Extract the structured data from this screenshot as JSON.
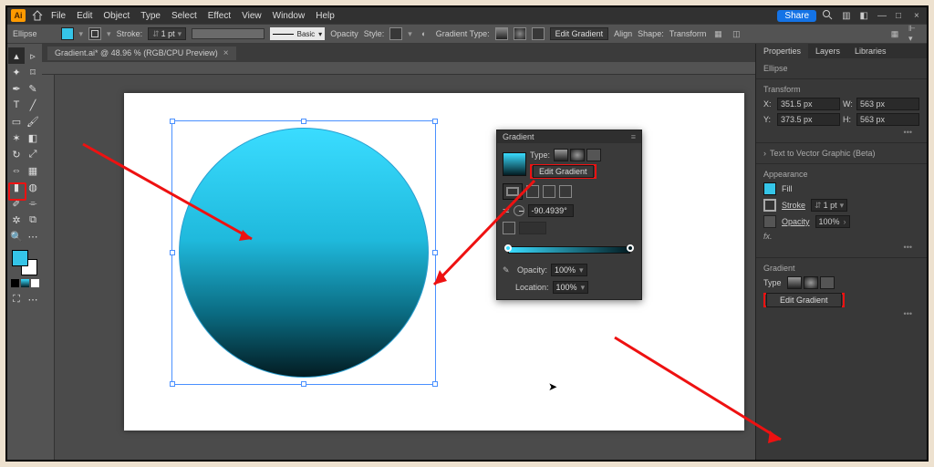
{
  "app": {
    "name": "Ai"
  },
  "menu": {
    "items": [
      "File",
      "Edit",
      "Object",
      "Type",
      "Select",
      "Effect",
      "View",
      "Window",
      "Help"
    ]
  },
  "titlebar": {
    "share": "Share"
  },
  "controlbar": {
    "object": "Ellipse",
    "stroke_label": "Stroke:",
    "stroke_val": "1 pt",
    "basic": "Basic",
    "opacity_label": "Opacity",
    "style_label": "Style:",
    "grad_type_label": "Gradient Type:",
    "edit_gradient": "Edit Gradient",
    "align": "Align",
    "shape": "Shape:",
    "transform": "Transform"
  },
  "document": {
    "tab": "Gradient.ai* @ 48.96 % (RGB/CPU Preview)"
  },
  "gradient_panel": {
    "title": "Gradient",
    "type_label": "Type:",
    "edit": "Edit Gradient",
    "angle": "-90.4939°",
    "opacity_label": "Opacity:",
    "opacity_val": "100%",
    "location_label": "Location:",
    "location_val": "100%"
  },
  "properties": {
    "tab_props": "Properties",
    "tab_layers": "Layers",
    "tab_libs": "Libraries",
    "objtype": "Ellipse",
    "transform_label": "Transform",
    "x_label": "X:",
    "x": "351.5 px",
    "y_label": "Y:",
    "y": "373.5 px",
    "w_label": "W:",
    "w": "563 px",
    "h_label": "H:",
    "h": "563 px",
    "t2v": "Text to Vector Graphic (Beta)",
    "appearance_label": "Appearance",
    "fill_label": "Fill",
    "stroke_label": "Stroke",
    "stroke_val": "1 pt",
    "opacity_label": "Opacity",
    "opacity_val": "100%",
    "fx": "fx.",
    "grad_label": "Gradient",
    "type_label": "Type",
    "edit": "Edit Gradient"
  }
}
